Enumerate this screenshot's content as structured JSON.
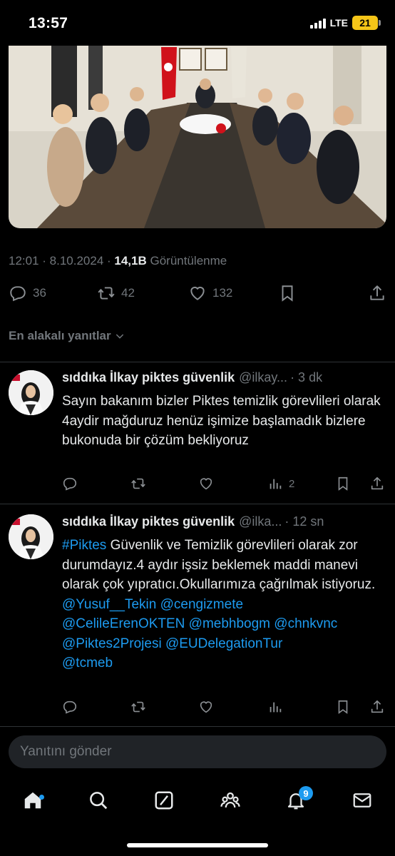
{
  "status_bar": {
    "time": "13:57",
    "network": "LTE",
    "battery": "21"
  },
  "photo": {
    "description_icon": "meeting-photo"
  },
  "tweet_meta": {
    "time": "12:01 · 8.10.2024 · ",
    "views_count": "14,1B",
    "views_label": "Görüntülenme"
  },
  "tweet_actions": {
    "replies": "36",
    "retweets": "42",
    "likes": "132"
  },
  "sort": {
    "label": "En alakalı yanıtlar"
  },
  "replies": [
    {
      "name": "sıddıka İlkay piktes güvenlik",
      "handle": "@ilkay...",
      "time": "· 3 dk",
      "text": "Sayın bakanım bizler Piktes temizlik görevlileri olarak 4aydir mağduruz henüz işimize başlamadık bizlere bukonuda bir çözüm bekliyoruz",
      "views": "2"
    },
    {
      "name": "sıddıka İlkay piktes güvenlik",
      "handle": "@ilka...",
      "time": "· 12 sn",
      "hashtag": "#Piktes",
      "text": " Güvenlik ve Temizlik görevlileri olarak zor durumdayız.4 aydır işsiz beklemek maddi manevi olarak çok yıpratıcı.Okullarımıza çağrılmak istiyoruz.",
      "mentions_line1": "@Yusuf__Tekin @cengizmete",
      "mentions_line2": "@CelileErenOKTEN @mebhbogm @chnkvnc",
      "mentions_line3": "@Piktes2Projesi @EUDelegationTur",
      "mentions_line4": "@tcmeb",
      "views": ""
    }
  ],
  "compose": {
    "placeholder": "Yanıtını gönder"
  },
  "tabbar": {
    "notifications_badge": "9"
  },
  "colors": {
    "accent": "#1d9bf0",
    "muted": "#71767b",
    "text": "#e7e9ea",
    "background": "#000000"
  }
}
